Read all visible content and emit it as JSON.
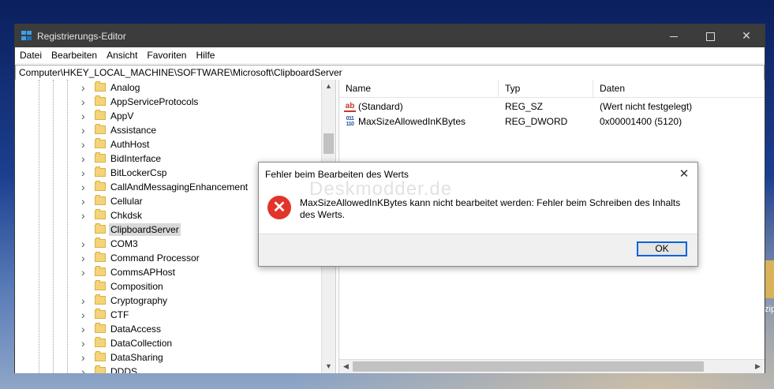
{
  "window": {
    "title": "Registrierungs-Editor"
  },
  "menu": [
    "Datei",
    "Bearbeiten",
    "Ansicht",
    "Favoriten",
    "Hilfe"
  ],
  "address": "Computer\\HKEY_LOCAL_MACHINE\\SOFTWARE\\Microsoft\\ClipboardServer",
  "tree": {
    "items": [
      {
        "label": "Analog",
        "expandable": true
      },
      {
        "label": "AppServiceProtocols",
        "expandable": true
      },
      {
        "label": "AppV",
        "expandable": true
      },
      {
        "label": "Assistance",
        "expandable": true
      },
      {
        "label": "AuthHost",
        "expandable": true
      },
      {
        "label": "BidInterface",
        "expandable": true
      },
      {
        "label": "BitLockerCsp",
        "expandable": true
      },
      {
        "label": "CallAndMessagingEnhancement",
        "expandable": true
      },
      {
        "label": "Cellular",
        "expandable": true
      },
      {
        "label": "Chkdsk",
        "expandable": true
      },
      {
        "label": "ClipboardServer",
        "expandable": false,
        "selected": true
      },
      {
        "label": "COM3",
        "expandable": true
      },
      {
        "label": "Command Processor",
        "expandable": true
      },
      {
        "label": "CommsAPHost",
        "expandable": true
      },
      {
        "label": "Composition",
        "expandable": false
      },
      {
        "label": "Cryptography",
        "expandable": true
      },
      {
        "label": "CTF",
        "expandable": true
      },
      {
        "label": "DataAccess",
        "expandable": true
      },
      {
        "label": "DataCollection",
        "expandable": true
      },
      {
        "label": "DataSharing",
        "expandable": true
      },
      {
        "label": "DDDS",
        "expandable": true
      }
    ]
  },
  "list": {
    "columns": {
      "name": "Name",
      "type": "Typ",
      "data": "Daten"
    },
    "rows": [
      {
        "icon": "string-value-icon",
        "icon_text": "ab",
        "name": "(Standard)",
        "type": "REG_SZ",
        "data": "(Wert nicht festgelegt)"
      },
      {
        "icon": "dword-value-icon",
        "icon_text": "011 110",
        "name": "MaxSizeAllowedInKBytes",
        "type": "REG_DWORD",
        "data": "0x00001400 (5120)"
      }
    ]
  },
  "dialog": {
    "title": "Fehler beim Bearbeiten des Werts",
    "message": "MaxSizeAllowedInKBytes kann nicht bearbeitet werden: Fehler beim Schreiben des Inhalts des Werts.",
    "watermark": "Deskmodder.de",
    "ok_label": "OK"
  },
  "desktop": {
    "partial_label": "zip"
  }
}
